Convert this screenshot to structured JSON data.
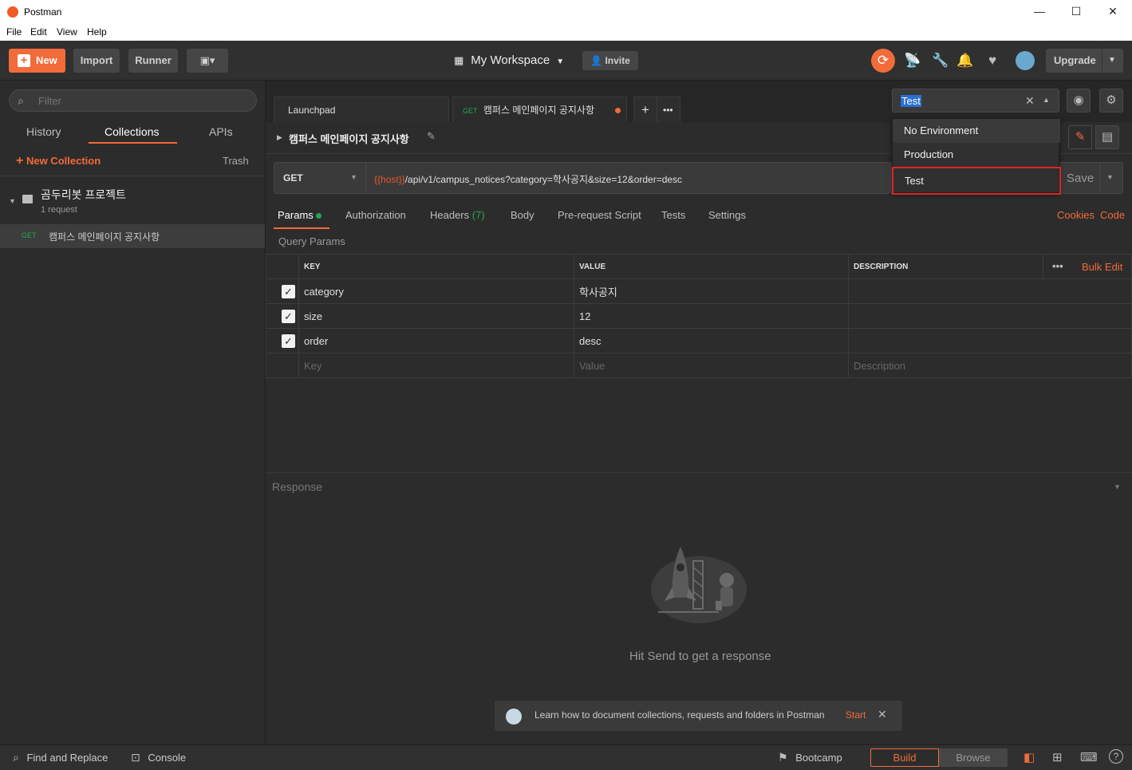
{
  "window": {
    "title": "Postman",
    "minimize": "—",
    "maximize": "☐",
    "close": "✕"
  },
  "menu": [
    "File",
    "Edit",
    "View",
    "Help"
  ],
  "header": {
    "new": "New",
    "import": "Import",
    "runner": "Runner",
    "workspace": "My Workspace",
    "invite": "Invite",
    "upgrade": "Upgrade"
  },
  "sidebar": {
    "filter_placeholder": "Filter",
    "tabs": [
      "History",
      "Collections",
      "APIs"
    ],
    "new_collection": "New Collection",
    "trash": "Trash",
    "collection": {
      "name": "곰두리봇 프로젝트",
      "count": "1 request"
    },
    "request": {
      "method": "GET",
      "name": "캠퍼스 메인페이지 공지사항"
    }
  },
  "tabs": {
    "launchpad": "Launchpad",
    "active": {
      "method": "GET",
      "name": "캠퍼스 메인페이지 공지사항"
    }
  },
  "request": {
    "title": "캠퍼스 메인페이지 공지사항",
    "method": "GET",
    "url_var": "{{host}}",
    "url_rest": "/api/v1/campus_notices?category=학사공지&size=12&order=desc",
    "save": "Save",
    "tabs": [
      "Params",
      "Authorization",
      "Headers",
      "Body",
      "Pre-request Script",
      "Tests",
      "Settings"
    ],
    "headers_count": "(7)",
    "cookies": "Cookies",
    "code": "Code",
    "query_params_label": "Query Params"
  },
  "environment": {
    "selected": "Test",
    "options": [
      "No Environment",
      "Production",
      "Test"
    ]
  },
  "params_table": {
    "headers": [
      "KEY",
      "VALUE",
      "DESCRIPTION"
    ],
    "bulk_edit": "Bulk Edit",
    "rows": [
      {
        "key": "category",
        "value": "학사공지",
        "desc": ""
      },
      {
        "key": "size",
        "value": "12",
        "desc": ""
      },
      {
        "key": "order",
        "value": "desc",
        "desc": ""
      }
    ],
    "placeholder": {
      "key": "Key",
      "value": "Value",
      "desc": "Description"
    }
  },
  "response": {
    "label": "Response",
    "empty": "Hit Send to get a response",
    "tip": "Learn how to document collections, requests and folders in Postman",
    "tip_link": "Start"
  },
  "footer": {
    "find_replace": "Find and Replace",
    "console": "Console",
    "bootcamp": "Bootcamp",
    "build": "Build",
    "browse": "Browse"
  },
  "colors": {
    "accent": "#f26b3a",
    "get": "#1fa84d",
    "var": "#e8572a"
  }
}
